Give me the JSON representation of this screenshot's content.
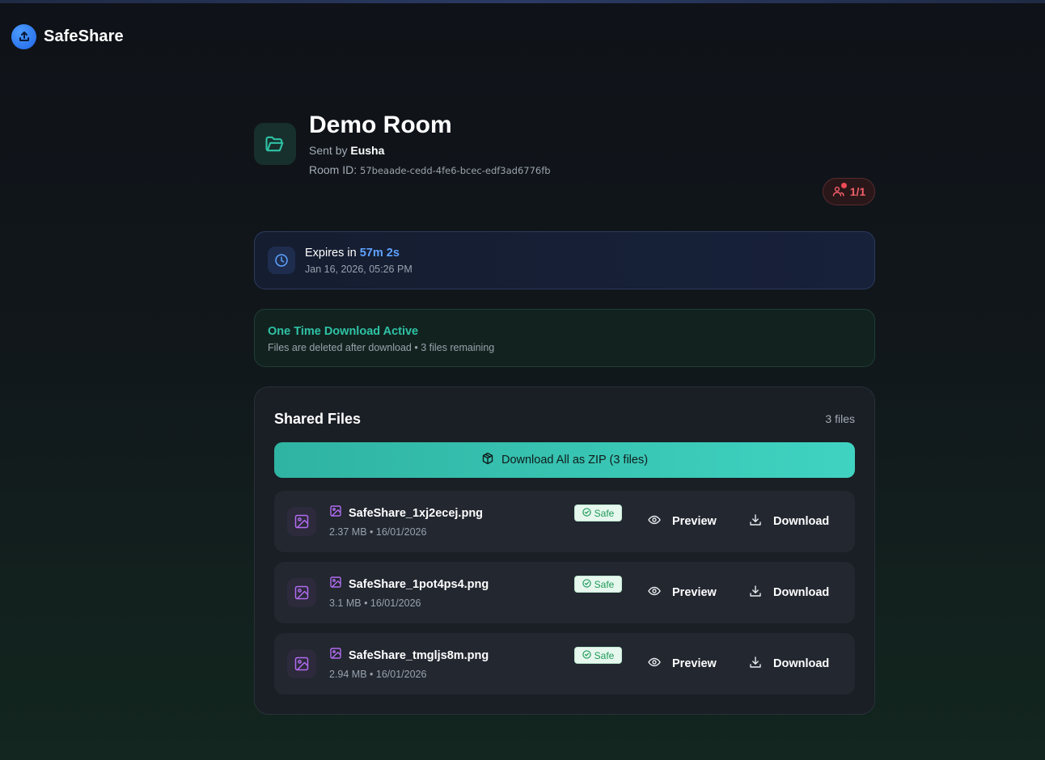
{
  "app": {
    "name": "SafeShare",
    "logo_icon": "upload-icon",
    "accent": "#2166e6"
  },
  "room": {
    "title": "Demo Room",
    "sent_by_prefix": "Sent by",
    "sender": "Eusha",
    "room_id_label": "Room ID:",
    "room_id": "57beaade-cedd-4fe6-bcec-edf3ad6776fb",
    "viewers": "1/1",
    "viewers_color": "#f0606a"
  },
  "expiry": {
    "prefix": "Expires in",
    "countdown": "57m 2s",
    "datetime": "Jan 16, 2026, 05:26 PM"
  },
  "one_time": {
    "title": "One Time Download Active",
    "subtitle": "Files are deleted after download • 3 files remaining",
    "accent": "#2fc2a6"
  },
  "files": {
    "heading": "Shared Files",
    "count_label": "3 files",
    "zip_label": "Download All as ZIP (3 files)",
    "preview_label": "Preview",
    "download_label": "Download",
    "safe_label": "Safe",
    "items": [
      {
        "name": "SafeShare_1xj2ecej.png",
        "meta": "2.37 MB • 16/01/2026",
        "status": "Safe"
      },
      {
        "name": "SafeShare_1pot4ps4.png",
        "meta": "3.1 MB • 16/01/2026",
        "status": "Safe"
      },
      {
        "name": "SafeShare_tmgljs8m.png",
        "meta": "2.94 MB • 16/01/2026",
        "status": "Safe"
      }
    ]
  }
}
